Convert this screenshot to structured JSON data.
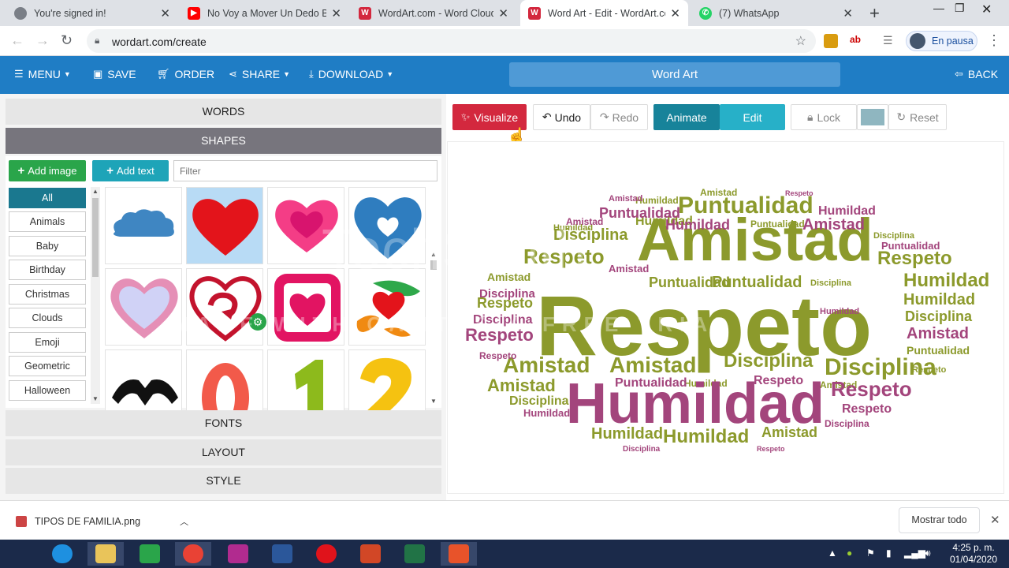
{
  "browser": {
    "tabs": [
      {
        "title": "You're signed in!",
        "favicon": "globe-icon"
      },
      {
        "title": "No Voy a Mover Un Dedo Bl",
        "favicon": "youtube-icon"
      },
      {
        "title": "WordArt.com - Word Cloud",
        "favicon": "wordart-icon"
      },
      {
        "title": "Word Art - Edit - WordArt.cc",
        "favicon": "wordart-icon"
      },
      {
        "title": "(7) WhatsApp",
        "favicon": "whatsapp-icon"
      }
    ],
    "url": "wordart.com/create",
    "profile_label": "En pausa"
  },
  "header": {
    "menu": "MENU",
    "save": "SAVE",
    "order": "ORDER",
    "share": "SHARE",
    "download": "DOWNLOAD",
    "title": "Word Art",
    "back": "BACK"
  },
  "left_panel": {
    "words": "WORDS",
    "shapes": "SHAPES",
    "fonts": "FONTS",
    "layout": "LAYOUT",
    "style": "STYLE",
    "add_image": "Add image",
    "add_text": "Add text",
    "filter_placeholder": "Filter",
    "categories": [
      "All",
      "Animals",
      "Baby",
      "Birthday",
      "Christmas",
      "Clouds",
      "Emoji",
      "Geometric",
      "Halloween"
    ]
  },
  "toolbar": {
    "visualize": "Visualize",
    "undo": "Undo",
    "redo": "Redo",
    "animate": "Animate",
    "edit": "Edit",
    "lock": "Lock",
    "reset": "Reset"
  },
  "wordcloud": {
    "colors": {
      "olive": "#8c9a2c",
      "magenta": "#a3457c"
    },
    "watermark_top": "TechSmith",
    "watermark_bottom": "MADE WITH CAMTASIA FREE TRIAL"
  },
  "downloads": {
    "file": "TIPOS DE FAMILIA.png",
    "show_all": "Mostrar todo"
  },
  "taskbar": {
    "time": "4:25 p. m.",
    "date": "01/04/2020"
  }
}
